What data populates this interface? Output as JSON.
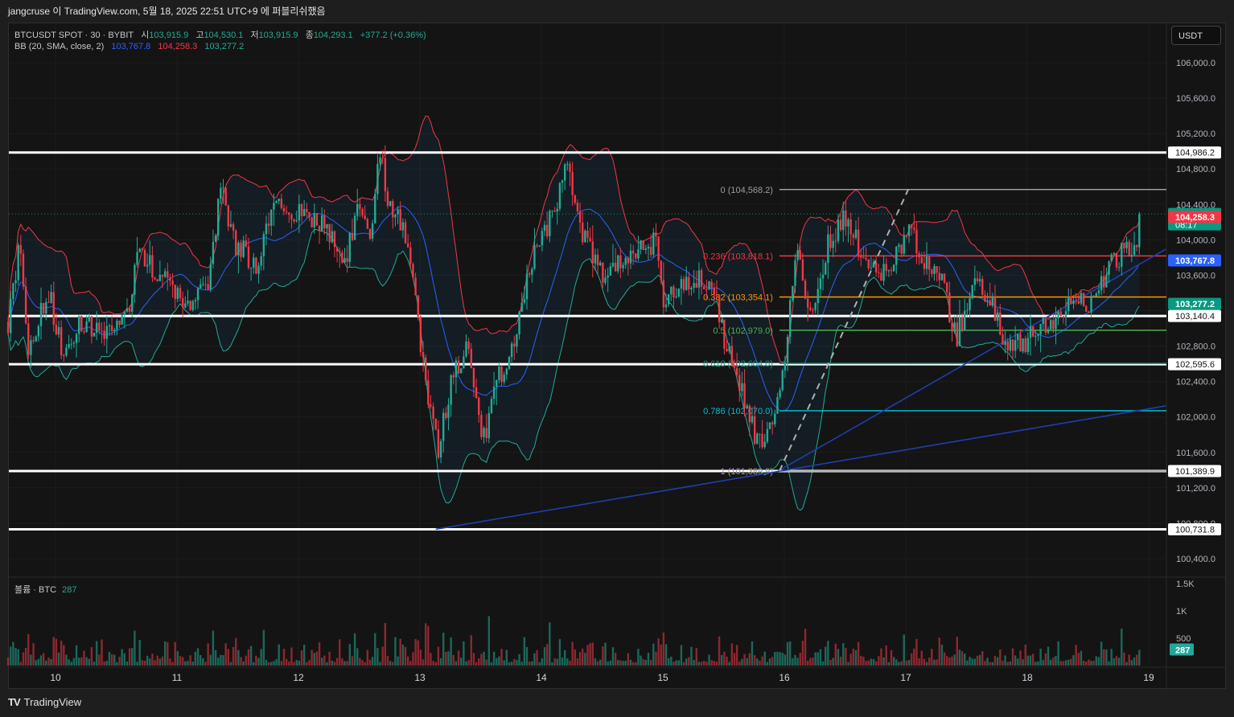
{
  "header": {
    "published": "jangcruse 이 TradingView.com, 5월 18, 2025 22:51 UTC+9 에 퍼블리쉬했음"
  },
  "legend": {
    "symbol": "BTCUSDT SPOT · 30 · BYBIT",
    "open_label": "시",
    "open": "103,915.9",
    "high_label": "고",
    "high": "104,530.1",
    "low_label": "저",
    "low": "103,915.9",
    "close_label": "종",
    "close": "104,293.1",
    "change": "+377.2 (+0.36%)",
    "bb_label": "BB (20, SMA, close, 2)",
    "bb_basis": "103,767.8",
    "bb_upper": "104,258.3",
    "bb_lower": "103,277.2"
  },
  "currency_button": "USDT",
  "volume_legend": {
    "label": "볼륨 · BTC",
    "value": "287"
  },
  "footer": {
    "brand": "TradingView",
    "logo": "TV"
  },
  "colors": {
    "up": "#22ab94",
    "down": "#f23645",
    "bb_basis": "#2962ff",
    "bb_upper": "#f23645",
    "bb_lower": "#22ab94",
    "background": "#141414"
  },
  "chart_data": {
    "type": "candlestick",
    "interval_minutes": 30,
    "x_unit": "day of May 2025",
    "x_ticks": [
      "10",
      "11",
      "12",
      "13",
      "14",
      "15",
      "16",
      "17",
      "18",
      "19"
    ],
    "x_tick_values": [
      10,
      11,
      12,
      13,
      14,
      15,
      16,
      17,
      18,
      19
    ],
    "ylim": [
      100200,
      106300
    ],
    "y_ticks": [
      106000,
      105600,
      105200,
      104800,
      104400,
      104000,
      103600,
      103200,
      102800,
      102400,
      102000,
      101600,
      101200,
      100800,
      100400
    ],
    "y_tick_labels": [
      "106,000.0",
      "105,600.0",
      "105,200.0",
      "104,800.0",
      "104,400.0",
      "104,000.0",
      "103,600.0",
      "103,200.0",
      "102,800.0",
      "102,400.0",
      "102,000.0",
      "101,600.0",
      "101,200.0",
      "100,800.0",
      "100,400.0"
    ],
    "approx_close_path": [
      [
        9.61,
        103077
      ],
      [
        9.71,
        103985
      ],
      [
        9.77,
        102714
      ],
      [
        9.94,
        103440
      ],
      [
        10.07,
        102624
      ],
      [
        10.21,
        103077
      ],
      [
        10.4,
        102896
      ],
      [
        10.6,
        103168
      ],
      [
        10.67,
        103804
      ],
      [
        10.87,
        103622
      ],
      [
        11.07,
        103259
      ],
      [
        11.26,
        103440
      ],
      [
        11.36,
        104620
      ],
      [
        11.46,
        103985
      ],
      [
        11.66,
        103713
      ],
      [
        11.83,
        104530
      ],
      [
        11.93,
        104348
      ],
      [
        12.19,
        104167
      ],
      [
        12.39,
        103804
      ],
      [
        12.49,
        104348
      ],
      [
        12.59,
        103985
      ],
      [
        12.67,
        105074
      ],
      [
        12.72,
        104530
      ],
      [
        12.85,
        104167
      ],
      [
        12.95,
        103531
      ],
      [
        13.02,
        102624
      ],
      [
        13.15,
        101625
      ],
      [
        13.25,
        102352
      ],
      [
        13.38,
        102805
      ],
      [
        13.52,
        101716
      ],
      [
        13.65,
        102443
      ],
      [
        13.78,
        102896
      ],
      [
        13.91,
        103713
      ],
      [
        14.08,
        104258
      ],
      [
        14.21,
        104802
      ],
      [
        14.31,
        104167
      ],
      [
        14.48,
        103622
      ],
      [
        14.64,
        103713
      ],
      [
        14.84,
        103894
      ],
      [
        14.94,
        103985
      ],
      [
        15.01,
        103259
      ],
      [
        15.11,
        103440
      ],
      [
        15.3,
        103531
      ],
      [
        15.4,
        103531
      ],
      [
        15.5,
        102896
      ],
      [
        15.64,
        102352
      ],
      [
        15.77,
        101716
      ],
      [
        15.9,
        101897
      ],
      [
        16.0,
        102624
      ],
      [
        16.1,
        103894
      ],
      [
        16.23,
        103077
      ],
      [
        16.36,
        103985
      ],
      [
        16.5,
        104258
      ],
      [
        16.63,
        103894
      ],
      [
        16.76,
        103622
      ],
      [
        16.89,
        103713
      ],
      [
        17.03,
        104167
      ],
      [
        17.16,
        103713
      ],
      [
        17.29,
        103531
      ],
      [
        17.42,
        102896
      ],
      [
        17.56,
        103531
      ],
      [
        17.69,
        103350
      ],
      [
        17.79,
        102896
      ],
      [
        17.95,
        102805
      ],
      [
        18.15,
        103077
      ],
      [
        18.28,
        103168
      ],
      [
        18.42,
        103350
      ],
      [
        18.55,
        103259
      ],
      [
        18.68,
        103713
      ],
      [
        18.81,
        103894
      ],
      [
        18.91,
        103894
      ],
      [
        18.94,
        104293.1
      ]
    ],
    "volume": {
      "ylim": [
        0,
        1600
      ],
      "y_ticks": [
        500,
        1000,
        1500
      ],
      "y_tick_labels": [
        "500",
        "1K",
        "1.5K"
      ],
      "last": 287
    },
    "horizontal_levels": [
      {
        "price": 104986.2,
        "label": "104,986.2"
      },
      {
        "price": 103140.4,
        "label": "103,140.4"
      },
      {
        "price": 102595.6,
        "label": "102,595.6"
      },
      {
        "price": 101389.9,
        "label": "101,389.9"
      },
      {
        "price": 100731.8,
        "label": "100,731.8"
      }
    ],
    "fibonacci": {
      "start_day": 15.96,
      "levels": [
        {
          "ratio": 0,
          "price": 104568.2,
          "label": "0 (104,568.2)",
          "color": "#9e9e9e"
        },
        {
          "ratio": 0.236,
          "price": 103818.1,
          "label": "0.236 (103,818.1)",
          "color": "#f23645"
        },
        {
          "ratio": 0.382,
          "price": 103354.1,
          "label": "0.382 (103,354.1)",
          "color": "#ff9800"
        },
        {
          "ratio": 0.5,
          "price": 102979.0,
          "label": "0.5 (102,979.0)",
          "color": "#4caf50"
        },
        {
          "ratio": 0.618,
          "price": 102604.0,
          "label": "0.618 (102,604.0)",
          "color": "#089981"
        },
        {
          "ratio": 0.786,
          "price": 102070.0,
          "label": "0.786 (102,070.0)",
          "color": "#00bcd4"
        },
        {
          "ratio": 1,
          "price": 101389.9,
          "label": "1 (101,389.9)",
          "color": "#9e9e9e"
        }
      ]
    },
    "trend_lines": [
      {
        "from": [
          13.13,
          100731.8
        ],
        "to": [
          19.14,
          102125
        ],
        "color": "#1e3fae",
        "dashed": false
      },
      {
        "from": [
          15.95,
          101389.9
        ],
        "to": [
          19.14,
          103894
        ],
        "color": "#1e3fae",
        "dashed": false
      },
      {
        "from": [
          15.96,
          101389.9
        ],
        "to": [
          17.02,
          104568.2
        ],
        "color": "#b0b0b0",
        "dashed": true
      }
    ],
    "price_labels": [
      {
        "price": 104293.1,
        "label": "104,293.1",
        "sub": "08:17",
        "color": "#089981"
      },
      {
        "price": 104258.3,
        "label": "104,258.3",
        "color": "#f23645"
      },
      {
        "price": 103767.8,
        "label": "103,767.8",
        "color": "#2962ff"
      },
      {
        "price": 103277.2,
        "label": "103,277.2",
        "color": "#089981"
      }
    ]
  }
}
